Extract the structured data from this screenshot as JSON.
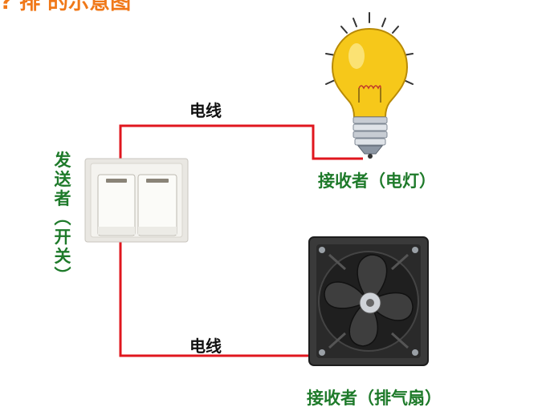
{
  "title": "? 排 的示意图",
  "wires": {
    "top_label": "电线",
    "bottom_label": "电线",
    "color": "#e0161e"
  },
  "sender": {
    "label": "发送者（开关）",
    "chars": [
      "发",
      "送",
      "者",
      "︵",
      "开",
      "关",
      "︶"
    ]
  },
  "receivers": {
    "lamp_label": "接收者（电灯）",
    "fan_label": "接收者（排气扇）"
  },
  "colors": {
    "title": "#f07818",
    "receiver_text": "#1e7a2a",
    "sender_text": "#1e7a2a",
    "bulb": "#f6c81a",
    "fan": "#2a2a2a"
  },
  "icons": [
    "light-bulb-icon",
    "exhaust-fan-icon",
    "wall-switch-icon"
  ]
}
